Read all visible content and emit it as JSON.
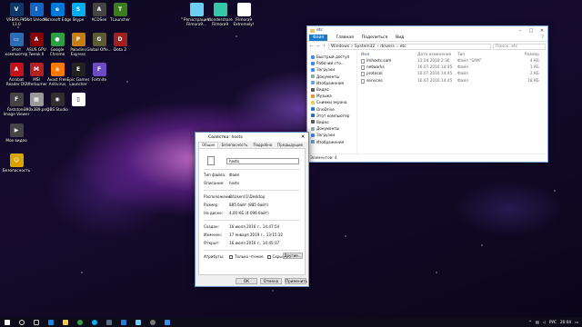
{
  "desktop": {
    "icons": [
      {
        "label": "VSBAS.Pro 13.0",
        "icon": "vsbas-icon",
        "color": "#0d3a6b",
        "glyph": "V"
      },
      {
        "label": "IObit Unlocker",
        "icon": "iobit-icon",
        "color": "#1565c0",
        "glyph": "I"
      },
      {
        "label": "Microsoft Edge",
        "icon": "edge-icon",
        "color": "#0078d7",
        "glyph": "e"
      },
      {
        "label": "Skype",
        "icon": "skype-icon",
        "color": "#00aff0",
        "glyph": "S"
      },
      {
        "label": "ACDSee",
        "icon": "acdsee-icon",
        "color": "#444",
        "glyph": "A"
      },
      {
        "label": "TLauncher",
        "icon": "tlauncher-icon",
        "color": "#3a7d1f",
        "glyph": "T"
      },
      {
        "label": "Этот компьютер",
        "icon": "computer-icon",
        "color": "#2a6db5",
        "glyph": "▭"
      },
      {
        "label": "ASUS GPU Tweak II",
        "icon": "asus-icon",
        "color": "#8b0000",
        "glyph": "A"
      },
      {
        "label": "Google Chrome",
        "icon": "chrome-icon",
        "color": "#2e9e45",
        "glyph": "●"
      },
      {
        "label": "Paladins Express",
        "icon": "paladins-icon",
        "color": "#c77d12",
        "glyph": "P"
      },
      {
        "label": "Global Offe...",
        "icon": "csgo-icon",
        "color": "#5b5b34",
        "glyph": "G"
      },
      {
        "label": "Dota 2",
        "icon": "dota-icon",
        "color": "#a02020",
        "glyph": "D"
      },
      {
        "label": "Acrobat Reader DC",
        "icon": "acrobat-icon",
        "color": "#c4111a",
        "glyph": "A"
      },
      {
        "label": "MSI Afterburner",
        "icon": "msi-icon",
        "color": "#b22222",
        "glyph": "M"
      },
      {
        "label": "Avast Free Antivirus",
        "icon": "avast-icon",
        "color": "#ff7800",
        "glyph": "a"
      },
      {
        "label": "Epic Games Launcher",
        "icon": "epic-icon",
        "color": "#222",
        "glyph": "E"
      },
      {
        "label": "Fortnite",
        "icon": "fortnite-icon",
        "color": "#6a4cc3",
        "glyph": "F"
      },
      {
        "label": "Faststone Image Viewer",
        "icon": "faststone-icon",
        "color": "#444",
        "glyph": "F"
      },
      {
        "label": "390x389.png",
        "icon": "image-file-icon",
        "color": "#999",
        "glyph": "▦"
      },
      {
        "label": "OBS Studio",
        "icon": "obs-icon",
        "color": "#302e31",
        "glyph": "◉"
      },
      {
        "label": "Мое видео",
        "icon": "video-folder-icon",
        "color": "#444",
        "glyph": "▶"
      },
      {
        "label": "Безопасность",
        "icon": "security-icon",
        "color": "#d9a400",
        "glyph": "☺"
      }
    ],
    "top_icons": [
      {
        "label": "Регистрация Filmora9...",
        "icon": "filmora-icon",
        "color": "#6ed0f0"
      },
      {
        "label": "Wondershare Filmora9",
        "icon": "wondershare-icon",
        "color": "#35c7a6"
      },
      {
        "label": "Filmora9 Extremely!",
        "icon": "filmora-x-icon",
        "color": "#ffffff"
      }
    ]
  },
  "explorer": {
    "title": "etc",
    "ribbon": [
      "Файл",
      "Главная",
      "Поделиться",
      "Вид"
    ],
    "help": "?",
    "address": [
      "Windows",
      "System32",
      "drivers",
      "etc"
    ],
    "search_placeholder": "Поиск: etc",
    "sidebar": [
      "Быстрый доступ",
      "Рабочий сто…",
      "Загрузки",
      "Документы",
      "Изображения",
      "Видео",
      "Музыка",
      "Снимки экрана",
      "OneDrive",
      "Этот компьютер",
      "Видео",
      "Документы",
      "Загрузки",
      "Изображения"
    ],
    "columns": [
      "Имя",
      "Дата изменения",
      "Тип",
      "Размер"
    ],
    "files": [
      {
        "name": "lmhosts.sam",
        "date": "12.04.2018 2:36",
        "type": "Файл \"SAM\"",
        "size": "4 КБ"
      },
      {
        "name": "networks",
        "date": "16.07.2016 14:45",
        "type": "Файл",
        "size": "1 КБ"
      },
      {
        "name": "protocol",
        "date": "16.07.2016 14:45",
        "type": "Файл",
        "size": "2 КБ"
      },
      {
        "name": "services",
        "date": "16.07.2016 14:45",
        "type": "Файл",
        "size": "18 КБ"
      }
    ],
    "status": "Элементов: 4"
  },
  "props": {
    "title": "Свойства: hosts",
    "tabs": [
      "Общие",
      "Безопасность",
      "Подробно",
      "Предыдущие версии"
    ],
    "name": "hosts",
    "type_label": "Тип файла:",
    "type_value": "Файл",
    "desc_label": "Описание:",
    "desc_value": "hosts",
    "loc_label": "Расположение:",
    "loc_value": "C:\\Users\\1\\Desktop",
    "size_label": "Размер:",
    "size_value": "885 байт (885 байт)",
    "disk_label": "На диске:",
    "disk_value": "4,00 КБ (4 096 байт)",
    "created_label": "Создан:",
    "created_value": "16 июля 2016 г., 14:47:54",
    "modified_label": "Изменен:",
    "modified_value": "17 января 2019 г., 13:15:32",
    "opened_label": "Открыт:",
    "opened_value": "16 июля 2016 г., 14:45:37",
    "attr_label": "Атрибуты:",
    "readonly": "Только чтение",
    "hidden": "Скрытый",
    "other": "Другие...",
    "ok": "ОК",
    "cancel": "Отмена",
    "apply": "Применить"
  },
  "taskbar": {
    "apps": [
      {
        "icon": "start-icon",
        "color": "#ffffff"
      },
      {
        "icon": "search-icon",
        "color": "#dddddd"
      },
      {
        "icon": "task-view-icon",
        "color": "#cccccc"
      },
      {
        "icon": "edge-taskbar-icon",
        "color": "#1b86e0"
      },
      {
        "icon": "explorer-taskbar-icon",
        "color": "#f2c94c"
      },
      {
        "icon": "chrome-taskbar-icon",
        "color": "#2e9e45"
      },
      {
        "icon": "skype-taskbar-icon",
        "color": "#00aff0"
      },
      {
        "icon": "steam-taskbar-icon",
        "color": "#1b2838"
      },
      {
        "icon": "store-taskbar-icon",
        "color": "#2b7cd3"
      },
      {
        "icon": "filmora-taskbar-icon",
        "color": "#6ed0f0"
      },
      {
        "icon": "obs-taskbar-icon",
        "color": "#555555"
      },
      {
        "icon": "mail-taskbar-icon",
        "color": "#3a8ee6"
      }
    ],
    "lang": "РУС",
    "time": "20:04"
  }
}
